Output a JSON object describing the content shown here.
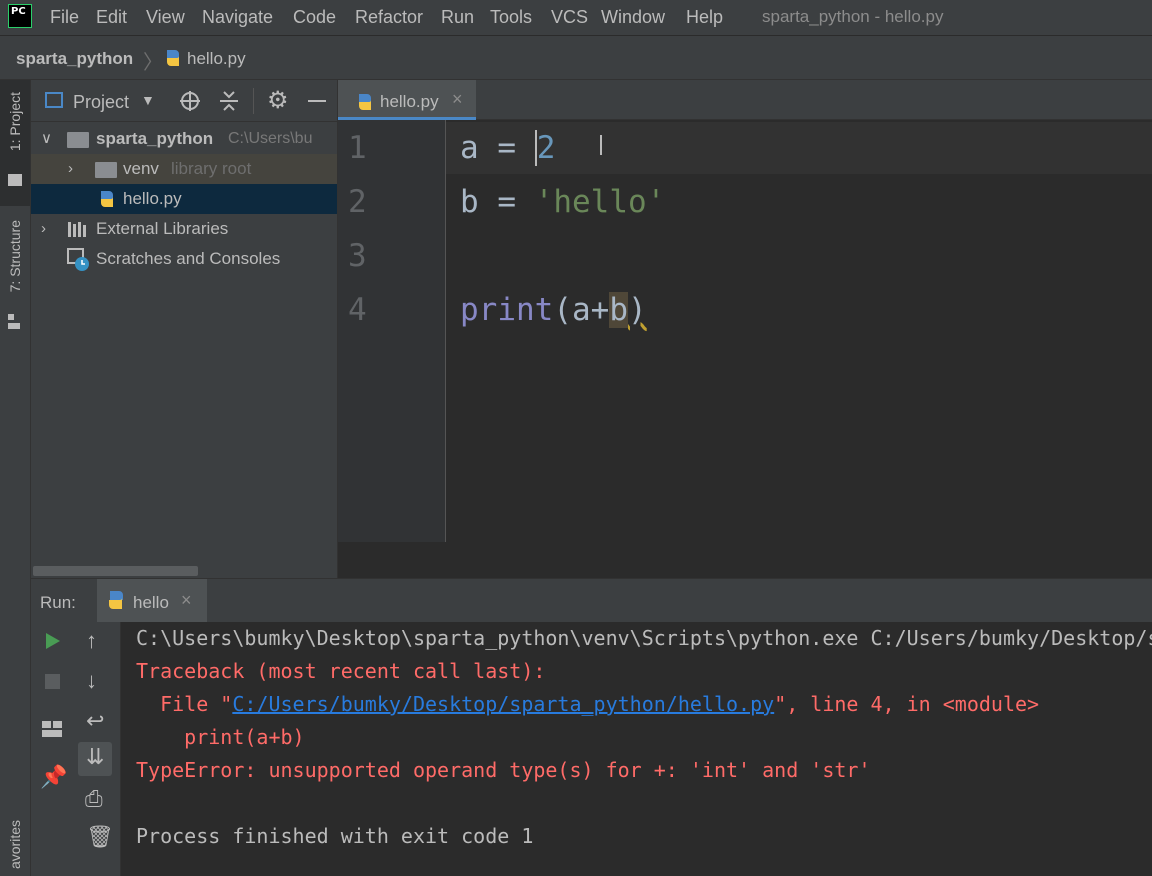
{
  "menubar": {
    "items": [
      "File",
      "Edit",
      "View",
      "Navigate",
      "Code",
      "Refactor",
      "Run",
      "Tools",
      "VCS",
      "Window",
      "Help"
    ],
    "window_title": "sparta_python - hello.py",
    "logo": "PC"
  },
  "breadcrumb": {
    "project": "sparta_python",
    "file": "hello.py"
  },
  "left_strip": {
    "project_tab": "1: Project",
    "structure_tab": "7: Structure",
    "favorites_tab": "avorites"
  },
  "project_panel": {
    "title": "Project",
    "tree": {
      "root_name": "sparta_python",
      "root_path": "C:\\Users\\bu",
      "venv_name": "venv",
      "venv_hint": "library root",
      "file_name": "hello.py",
      "external": "External Libraries",
      "scratches": "Scratches and Consoles"
    }
  },
  "editor": {
    "tab_label": "hello.py",
    "line_numbers": [
      "1",
      "2",
      "3",
      "4"
    ],
    "lines": {
      "l1_var": "a",
      "l1_eq": "=",
      "l1_num": "2",
      "l2_var": "b",
      "l2_eq": "=",
      "l2_str": "'hello'",
      "l4_fn": "print",
      "l4_open": "(",
      "l4_a": "a",
      "l4_plus": "+",
      "l4_b": "b",
      "l4_close": ")"
    }
  },
  "run": {
    "label": "Run:",
    "tab": "hello",
    "console": {
      "cmd": "C:\\Users\\bumky\\Desktop\\sparta_python\\venv\\Scripts\\python.exe C:/Users/bumky/Desktop/sparta_python/hello.py",
      "traceback": "Traceback (most recent call last):",
      "file_prefix": "  File \"",
      "file_link": "C:/Users/bumky/Desktop/sparta_python/hello.py",
      "file_suffix": "\", line 4, in <module>",
      "code": "    print(a+b)",
      "error": "TypeError: unsupported operand type(s) for +: 'int' and 'str'",
      "finished": "Process finished with exit code 1"
    }
  },
  "colors": {
    "keyword": "#a9b7c6",
    "number": "#6897bb",
    "string": "#6a8759",
    "builtin": "#8888c6",
    "error": "#ff6b68",
    "link": "#287bde",
    "selection": "#0d293e"
  }
}
